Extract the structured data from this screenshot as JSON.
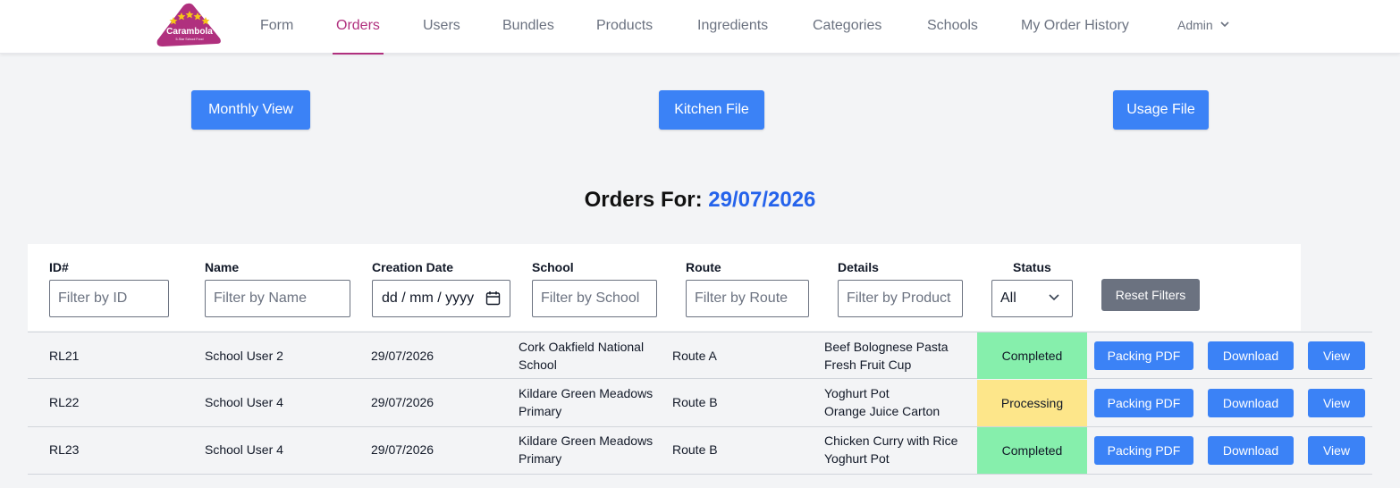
{
  "brand": {
    "logo_text": "Carambola",
    "tagline": "5-Star School Food",
    "logo_color": "#b0307e",
    "star_color": "#f5c518"
  },
  "nav": {
    "items": [
      {
        "label": "Form"
      },
      {
        "label": "Orders",
        "active": true
      },
      {
        "label": "Users"
      },
      {
        "label": "Bundles"
      },
      {
        "label": "Products"
      },
      {
        "label": "Ingredients"
      },
      {
        "label": "Categories"
      },
      {
        "label": "Schools"
      },
      {
        "label": "My Order History"
      }
    ],
    "user_menu": {
      "label": "Admin",
      "icon": "chevron-down-icon"
    }
  },
  "actions": {
    "monthly_view": "Monthly View",
    "kitchen_file": "Kitchen File",
    "usage_file": "Usage File"
  },
  "heading": {
    "prefix": "Orders For:",
    "date": "29/07/2026"
  },
  "filters": {
    "id": {
      "label": "ID#",
      "placeholder": "Filter by ID"
    },
    "name": {
      "label": "Name",
      "placeholder": "Filter by Name"
    },
    "creation_date": {
      "label": "Creation Date",
      "placeholder": "dd / mm / yyyy",
      "icon": "calendar-icon"
    },
    "school": {
      "label": "School",
      "placeholder": "Filter by School"
    },
    "route": {
      "label": "Route",
      "placeholder": "Filter by Route"
    },
    "details": {
      "label": "Details",
      "placeholder": "Filter by Product"
    },
    "status": {
      "label": "Status",
      "value": "All",
      "icon": "chevron-down-icon"
    },
    "reset_label": "Reset Filters"
  },
  "orders": [
    {
      "id": "RL21",
      "name": "School User 2",
      "date": "29/07/2026",
      "school_line1": "Cork Oakfield National",
      "school_line2": "School",
      "route": "Route A",
      "detail_line1": "Beef Bolognese Pasta",
      "detail_line2": "Fresh Fruit Cup",
      "status": "Completed",
      "packing_label": "Packing PDF",
      "download_label": "Download",
      "view_label": "View"
    },
    {
      "id": "RL22",
      "name": "School User 4",
      "date": "29/07/2026",
      "school_line1": "Kildare Green Meadows",
      "school_line2": "Primary",
      "route": "Route B",
      "detail_line1": "Yoghurt Pot",
      "detail_line2": "Orange Juice Carton",
      "status": "Processing",
      "packing_label": "Packing PDF",
      "download_label": "Download",
      "view_label": "View"
    },
    {
      "id": "RL23",
      "name": "School User 4",
      "date": "29/07/2026",
      "school_line1": "Kildare Green Meadows",
      "school_line2": "Primary",
      "route": "Route B",
      "detail_line1": "Chicken Curry with Rice",
      "detail_line2": "Yoghurt Pot",
      "status": "Completed",
      "packing_label": "Packing PDF",
      "download_label": "Download",
      "view_label": "View"
    }
  ],
  "colors": {
    "accent": "#3b82f6",
    "active_nav": "#b0307e",
    "completed": "#86efac",
    "processing": "#fde68a",
    "heading_date": "#2563eb",
    "reset": "#6b7280"
  }
}
